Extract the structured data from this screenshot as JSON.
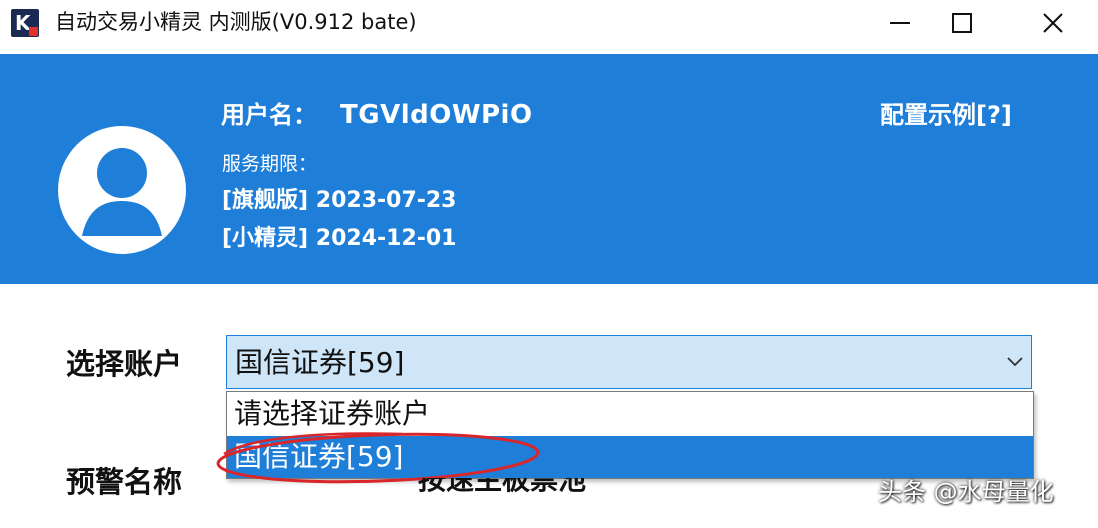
{
  "window": {
    "title": "自动交易小精灵 内测版(V0.912 bate)",
    "icon_letter": "K"
  },
  "header": {
    "username_label": "用户名：",
    "username": "TGVldOWPiO",
    "service_label": "服务期限：",
    "plans": [
      "[旗舰版] 2023-07-23",
      "[小精灵] 2024-12-01"
    ],
    "config_link": "配置示例[?]",
    "background_color": "#1e7ed8"
  },
  "form": {
    "account_label": "选择账户",
    "account_selected": "国信证券[59]",
    "account_options": [
      "请选择证券账户",
      "国信证券[59]"
    ],
    "highlighted_option_index": 1,
    "alert_label": "预警名称",
    "alert_value_partial": "按速主板票池"
  },
  "watermark": "头条 @水母量化",
  "annotation_color": "#d9262a"
}
